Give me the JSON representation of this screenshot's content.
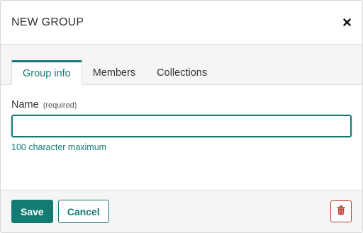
{
  "dialog": {
    "title": "NEW GROUP",
    "close_icon": "close-icon"
  },
  "tabs": [
    {
      "label": "Group info",
      "active": true
    },
    {
      "label": "Members",
      "active": false
    },
    {
      "label": "Collections",
      "active": false
    }
  ],
  "form": {
    "name_label": "Name",
    "name_required": "(required)",
    "name_value": "",
    "name_hint": "100 character maximum"
  },
  "footer": {
    "save_label": "Save",
    "cancel_label": "Cancel",
    "delete_icon": "trash-icon"
  },
  "colors": {
    "accent": "#147b74",
    "danger": "#c0392b"
  }
}
